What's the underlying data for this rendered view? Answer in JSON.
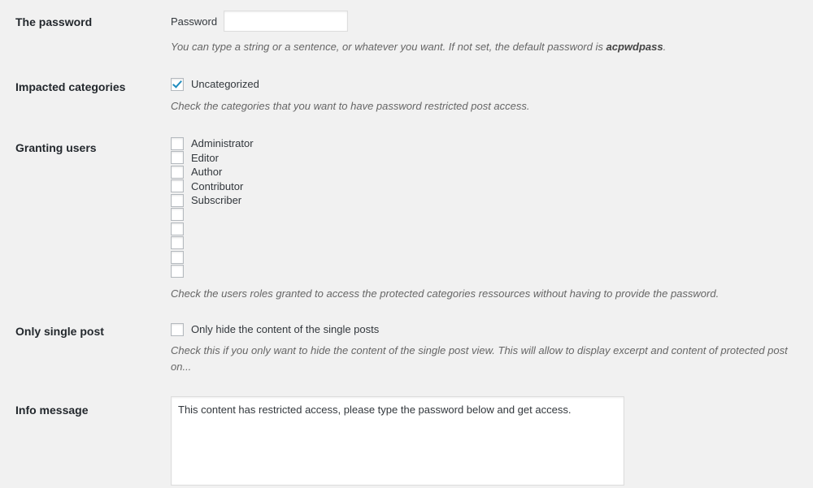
{
  "theme": {
    "background": "#f1f1f1",
    "label_color": "#23282d",
    "description_color": "#666666",
    "accent": "#1e8cbe",
    "field_border": "#dddddd",
    "checkbox_border": "#b4b9be"
  },
  "rows": {
    "password": {
      "label": "The password",
      "field_label": "Password",
      "value": "",
      "placeholder": "",
      "description_prefix": "You can type a string or a sentence, or whatever you want. If not set, the default password is ",
      "description_strong": "acpwdpass",
      "description_suffix": "."
    },
    "categories": {
      "label": "Impacted categories",
      "items": [
        {
          "label": "Uncategorized",
          "checked": true
        }
      ],
      "description": "Check the categories that you want to have password restricted post access."
    },
    "granting_users": {
      "label": "Granting users",
      "items": [
        {
          "label": "Administrator",
          "checked": false
        },
        {
          "label": "Editor",
          "checked": false
        },
        {
          "label": "Author",
          "checked": false
        },
        {
          "label": "Contributor",
          "checked": false
        },
        {
          "label": "Subscriber",
          "checked": false
        },
        {
          "label": "",
          "checked": false
        },
        {
          "label": "",
          "checked": false
        },
        {
          "label": "",
          "checked": false
        },
        {
          "label": "",
          "checked": false
        },
        {
          "label": "",
          "checked": false
        }
      ],
      "description": "Check the users roles granted to access the protected categories ressources without having to provide the password."
    },
    "single_post": {
      "label": "Only single post",
      "checkbox_label": "Only hide the content of the single posts",
      "checked": false,
      "description": "Check this if you only want to hide the content of the single post view. This will allow to display excerpt and content of protected post on..."
    },
    "info_message": {
      "label": "Info message",
      "value": "This content has restricted access, please type the password below and get access.",
      "placeholder": ""
    }
  }
}
